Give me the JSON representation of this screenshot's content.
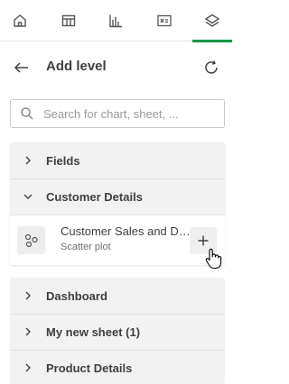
{
  "tabs": [
    {
      "icon": "home-icon",
      "active": false
    },
    {
      "icon": "table-icon",
      "active": false
    },
    {
      "icon": "chart-icon",
      "active": false
    },
    {
      "icon": "variable-icon",
      "active": false
    },
    {
      "icon": "layers-icon",
      "active": true
    }
  ],
  "header": {
    "title": "Add level",
    "back_icon": "arrow-left-icon",
    "refresh_icon": "refresh-icon"
  },
  "search": {
    "placeholder": "Search for chart, sheet, ..."
  },
  "sections": {
    "fields": {
      "label": "Fields",
      "expanded": false
    },
    "customer_details": {
      "label": "Customer Details",
      "expanded": true,
      "items": [
        {
          "title": "Customer Sales and Discount",
          "subtitle": "Scatter plot",
          "icon": "scatter-plot-icon"
        }
      ]
    },
    "dashboard": {
      "label": "Dashboard",
      "expanded": false
    },
    "my_new_sheet": {
      "label": "My new sheet (1)",
      "expanded": false
    },
    "product_details": {
      "label": "Product Details",
      "expanded": false
    }
  },
  "colors": {
    "accent": "#009845",
    "text": "#404040",
    "panel_bg": "#f2f2f2"
  }
}
